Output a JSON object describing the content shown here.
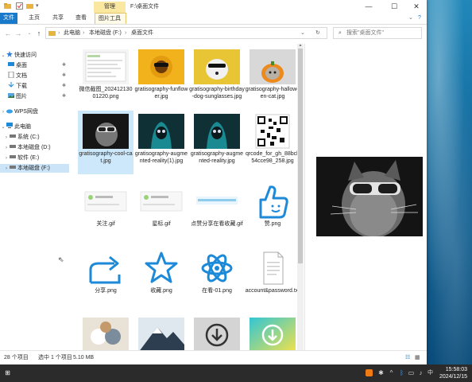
{
  "window": {
    "manage_tab": "管理",
    "title": "F:\\桌面文件",
    "minimize": "—",
    "maximize": "☐",
    "close": "✕"
  },
  "ribbon": {
    "tabs": [
      "文件",
      "主页",
      "共享",
      "查看",
      "图片工具"
    ],
    "help": "?"
  },
  "address": {
    "breadcrumb": [
      "此电脑",
      "本地磁盘 (F:)",
      "桌面文件"
    ],
    "search_placeholder": "搜索\"桌面文件\""
  },
  "nav": {
    "quick_access": "快速访问",
    "desktop": "桌面",
    "documents": "文档",
    "downloads": "下载",
    "pictures": "图片",
    "wps": "WPS网盘",
    "this_pc": "此电脑",
    "drive_c": "系统 (C:)",
    "drive_d": "本地磁盘 (D:)",
    "drive_e": "软件 (E:)",
    "drive_f": "本地磁盘 (F:)"
  },
  "files": [
    {
      "name": "微信截图_20241213001220.png"
    },
    {
      "name": "gratisography-funflower.jpg"
    },
    {
      "name": "gratisography-birthday-dog-sunglasses.jpg"
    },
    {
      "name": "gratisography-halloween-cat.jpg"
    },
    {
      "name": "gratisography-cool-cat.jpg"
    },
    {
      "name": "gratisography-augmented-reality(1).jpg"
    },
    {
      "name": "gratisography-augmented-reality.jpg"
    },
    {
      "name": "qrcode_for_gh_88bcb54cce98_258.jpg"
    },
    {
      "name": "关注.gif"
    },
    {
      "name": "星标.gif"
    },
    {
      "name": "点赞分享在看收藏.gif"
    },
    {
      "name": "赞.png"
    },
    {
      "name": "分享.png"
    },
    {
      "name": "收藏.png"
    },
    {
      "name": "在看-01.png"
    },
    {
      "name": "account&password.txt"
    }
  ],
  "status": {
    "count": "28 个项目",
    "selected": "选中 1 个项目",
    "size": "5.10 MB"
  },
  "taskbar": {
    "time": "15:58:03",
    "date": "2024/12/15"
  },
  "colors": {
    "accent": "#1979ca",
    "icon_blue": "#1c8ad8",
    "selection": "#cde8fb"
  }
}
